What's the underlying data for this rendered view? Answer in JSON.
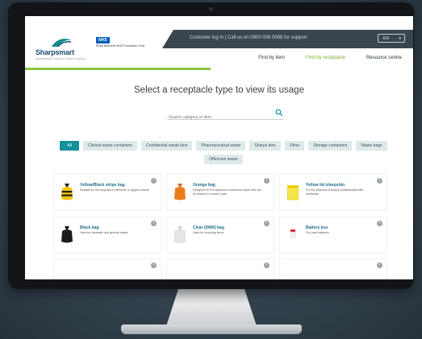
{
  "topbar": {
    "notice": "Customer log in | Call us on 0800 008 0088 for support",
    "language": "EN"
  },
  "brand": {
    "name": "Sharpsmart",
    "tagline": "SHARPSMART | HEALTH | SAFETY | WASTE",
    "partner_badge": "NHS",
    "partner_name": "Royal Berkshire NHS Foundation Trust"
  },
  "nav": [
    "Find by item",
    "Find by receptacle",
    "Resource centre"
  ],
  "page": {
    "title": "Select a receptacle type to view its usage",
    "search_placeholder": "Search category or item"
  },
  "filters": {
    "chips": [
      "All",
      "Clinical waste containers",
      "Confidential waste bins",
      "Pharmaceutical waste",
      "Sharps bins",
      "Other",
      "Storage containers",
      "Waste bags",
      "Offensive waste"
    ],
    "selected": "All"
  },
  "cards": [
    {
      "title": "Yellow/Black stripe bag",
      "desc": "Suitable for the disposal of offensive or hygiene waste",
      "icon": "yellow-black-bag"
    },
    {
      "title": "Orange bag",
      "desc": "Designed for the disposal of infectious waste that can be treated to render it safe",
      "icon": "orange-bag"
    },
    {
      "title": "Yellow lid sharpsbin",
      "desc": "For the disposal of sharps contaminated with medicines",
      "icon": "yellow-sharps-bin"
    },
    {
      "title": "Black bag",
      "desc": "Used for domestic and general waste",
      "icon": "black-bag"
    },
    {
      "title": "Clear (DMR) bag",
      "desc": "Used for recycling items",
      "icon": "clear-bag"
    },
    {
      "title": "Battery box",
      "desc": "For used batteries",
      "icon": "battery-box"
    }
  ],
  "colors": {
    "accent_green": "#8cc63f",
    "teal": "#14919b",
    "topbar": "#3a4550",
    "card_title": "#1c6e8c"
  }
}
